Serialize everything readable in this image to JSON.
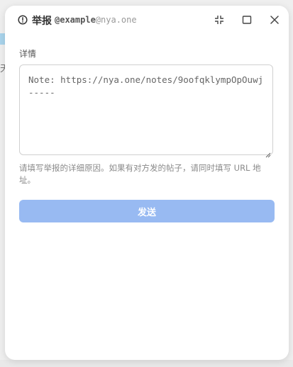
{
  "window": {
    "title": "举报",
    "user_name": "@example",
    "user_host": "@nya.one"
  },
  "form": {
    "details_label": "详情",
    "report_text": "Note: https://nya.one/notes/9oofqklympOpOuwj\n-----",
    "hint": "请填写举报的详细原因。如果有对方发的帖子，请同时填写 URL 地址。",
    "send_label": "发送"
  },
  "background": {
    "partial_glyph": "天"
  },
  "colors": {
    "send_button": "#98baf2",
    "text_primary": "#333333",
    "text_muted": "#8a8a8a"
  }
}
